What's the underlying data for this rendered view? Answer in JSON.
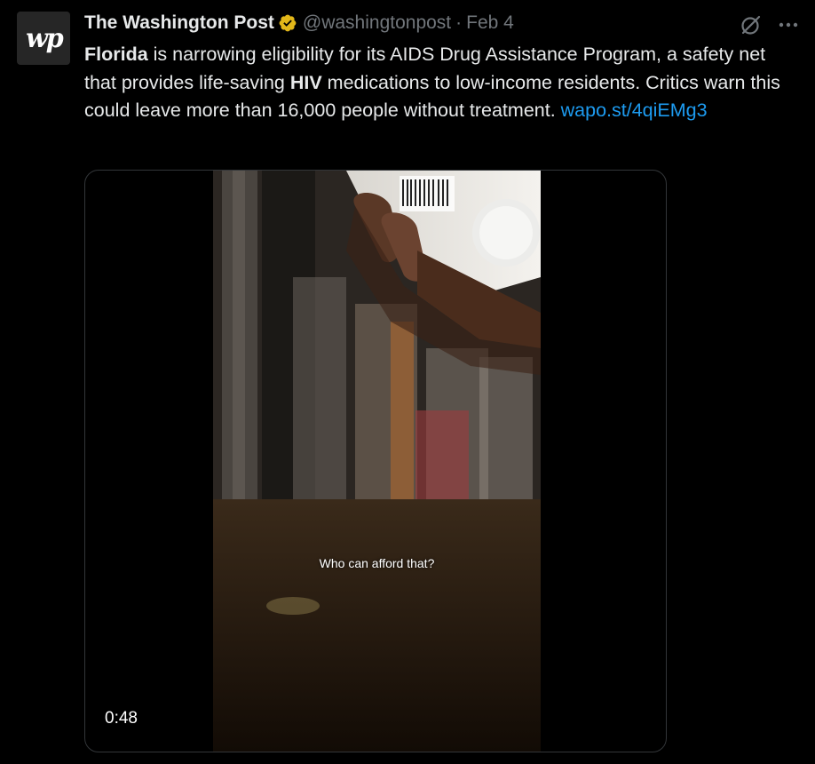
{
  "tweet": {
    "author": {
      "name": "The Washington Post",
      "handle": "@washingtonpost",
      "verified": true,
      "avatar_text": "wp"
    },
    "date": "Feb 4",
    "separator": "·",
    "text": {
      "part1_bold": "Florida",
      "part2": " is narrowing eligibility for its AIDS Drug Assistance Program, a safety net that provides life-saving ",
      "part3_bold": "HIV",
      "part4": " medications to low-income residents. Critics warn this could leave more than 16,000 people without treatment. ",
      "link": "wapo.st/4qiEMg3"
    },
    "media": {
      "type": "video",
      "caption": "Who can afford that?",
      "duration": "0:48"
    },
    "icons": {
      "verified": "verified-badge-icon",
      "grok": "grok-icon",
      "more": "more-icon"
    }
  },
  "colors": {
    "background": "#000000",
    "text": "#e7e9ea",
    "secondary": "#71767b",
    "link": "#1d9bf0",
    "verified": "#e2b719",
    "border": "#333639"
  }
}
